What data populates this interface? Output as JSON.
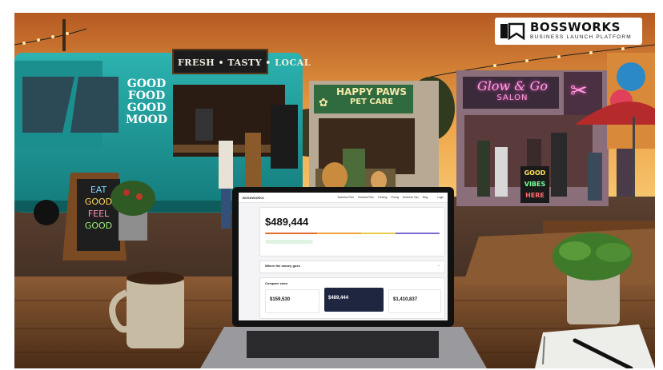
{
  "brand": {
    "name": "BOSSWORKS",
    "tagline": "BUSINESS LAUNCH PLATFORM"
  },
  "signs": {
    "truck_banner": "FRESH • TASTY • LOCAL",
    "truck_side": [
      "GOOD",
      "FOOD",
      "GOOD",
      "MOOD"
    ],
    "menu_board": [
      "EAT",
      "GOOD",
      "FEEL",
      "GOOD"
    ],
    "pet_shop": [
      "HAPPY PAWS",
      "PET CARE"
    ],
    "salon": [
      "Glow & Go",
      "SALON"
    ],
    "vibes_sign": [
      "GOOD",
      "VIBES",
      "HERE"
    ]
  },
  "laptop_screen": {
    "nav_brand": "BOSSWORKS",
    "nav_items": [
      "Business Plan",
      "Financial Plan",
      "Funding",
      "Pricing",
      "Business Tips",
      "Blog",
      "Login"
    ],
    "headline_value": "$489,444",
    "money_section": "Where the money goes",
    "compare_title": "Compare sizes",
    "compare_values": [
      "$159,530",
      "$489,444",
      "$1,410,837"
    ]
  },
  "colors": {
    "truck": "#1fa5a3",
    "sky_top": "#c46a2b",
    "sky_bottom": "#f4c06a",
    "pet_shop_sign": "#2f6b3e",
    "salon_neon": "#ff77d0"
  }
}
